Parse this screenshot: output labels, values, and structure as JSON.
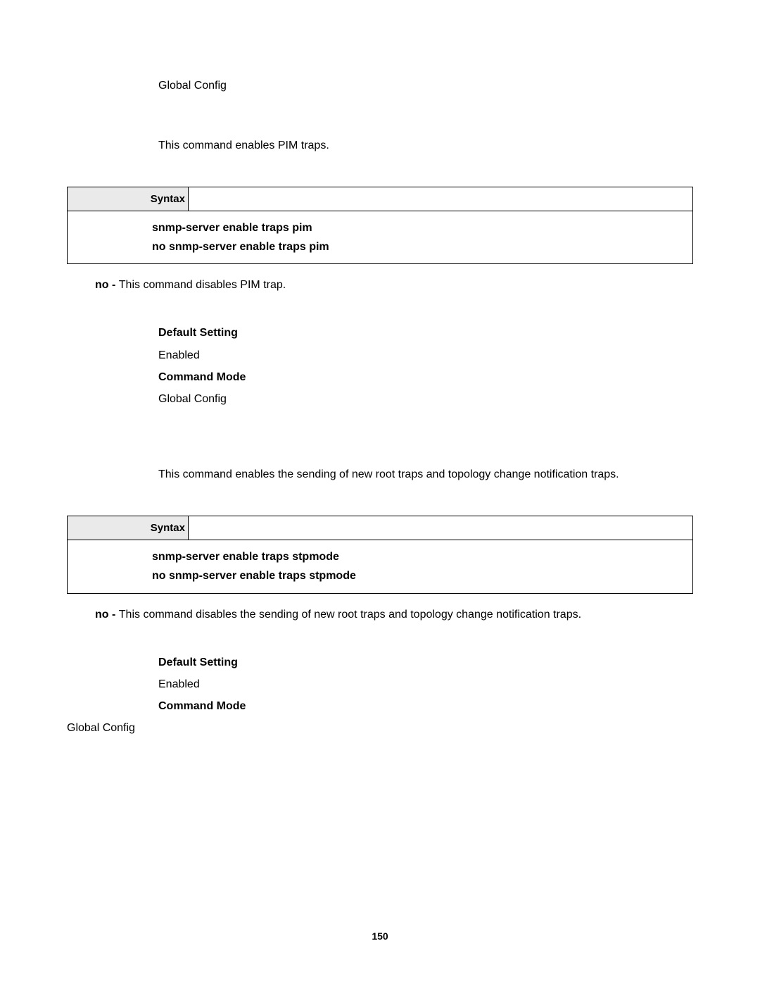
{
  "section1": {
    "mode_value": "Global Config"
  },
  "section2": {
    "description": "This command enables PIM traps.",
    "syntax_label": "Syntax",
    "syntax_line1": "snmp-server enable traps pim",
    "syntax_line2": "no snmp-server enable traps pim",
    "no_prefix": "no - ",
    "no_text": "This command disables PIM trap.",
    "default_label": "Default Setting",
    "default_value": "Enabled",
    "mode_label": "Command Mode",
    "mode_value": "Global Config"
  },
  "section3": {
    "description": "This command enables the sending of new root traps and topology change notification traps.",
    "syntax_label": "Syntax",
    "syntax_line1": "snmp-server enable traps stpmode",
    "syntax_line2": "no snmp-server enable traps stpmode",
    "no_prefix": "no - ",
    "no_text": "This command disables the sending of new root traps and topology change notification traps.",
    "default_label": "Default Setting",
    "default_value": "Enabled",
    "mode_label": "Command Mode",
    "mode_value": "Global Config"
  },
  "page_number": "150"
}
